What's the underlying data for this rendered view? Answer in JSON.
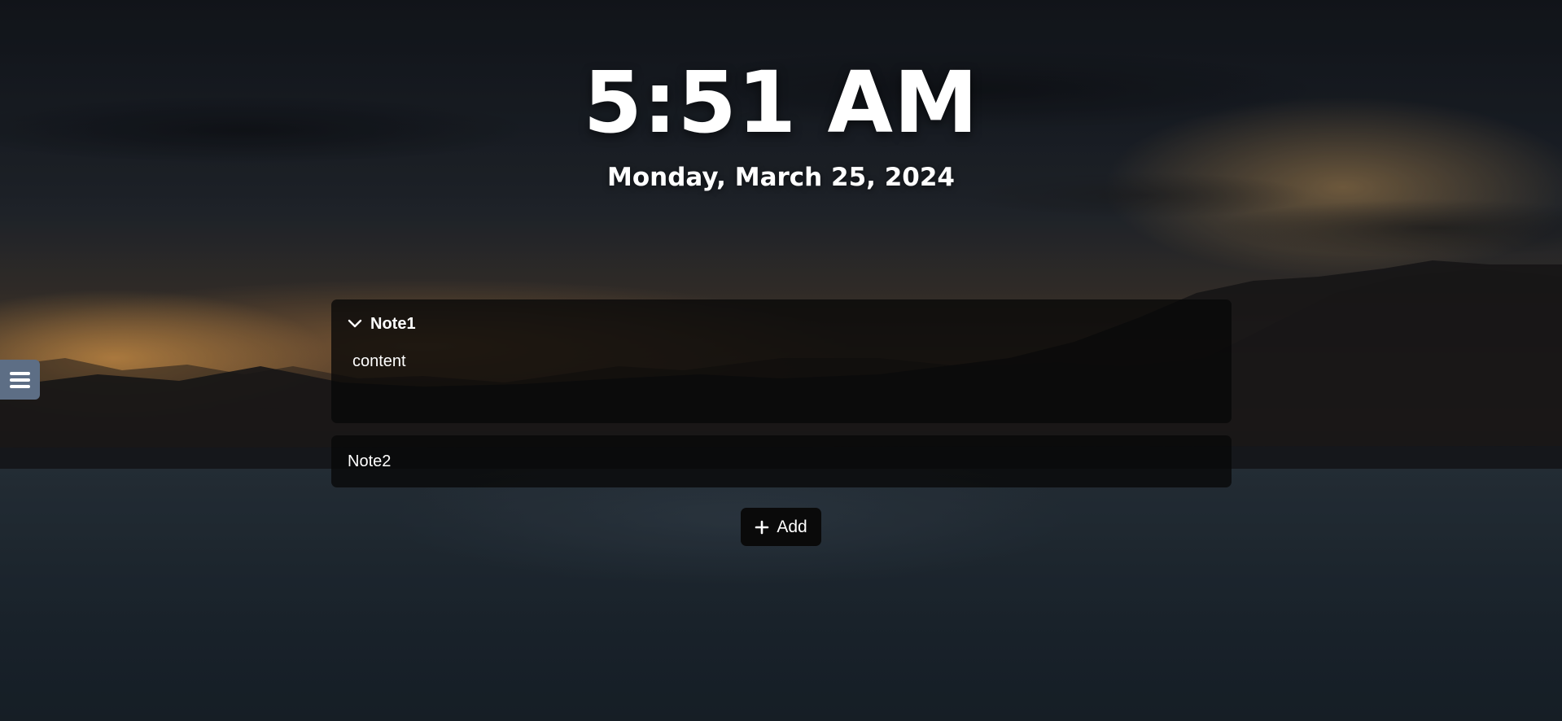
{
  "clock": {
    "time": "5:51 AM",
    "date": "Monday, March 25, 2024"
  },
  "sidebar_toggle": {
    "icon": "hamburger-menu-icon",
    "color": "#5d6e85"
  },
  "notes": [
    {
      "title": "Note1",
      "expanded": true,
      "content": "content",
      "icon": "chevron-down-icon"
    },
    {
      "title": "Note2",
      "expanded": false,
      "content": ""
    }
  ],
  "add_button": {
    "label": "Add",
    "icon": "plus-icon"
  }
}
